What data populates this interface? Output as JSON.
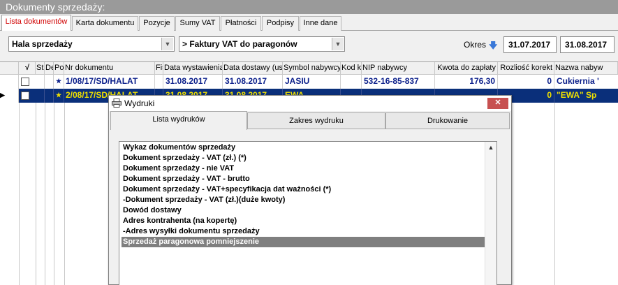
{
  "app": {
    "title": "Dokumenty sprzedaży:"
  },
  "tabs": [
    {
      "label": "Lista dokumentów",
      "active": true
    },
    {
      "label": "Karta dokumentu"
    },
    {
      "label": "Pozycje"
    },
    {
      "label": "Sumy VAT"
    },
    {
      "label": "Płatności"
    },
    {
      "label": "Podpisy"
    },
    {
      "label": "Inne dane"
    }
  ],
  "toolbar": {
    "combo1": "Hala sprzedaży",
    "combo2": "> Faktury VAT do paragonów",
    "okres_label": "Okres",
    "okres_arrow": "arrow-down-icon",
    "date_from": "31.07.2017",
    "date_to": "31.08.2017"
  },
  "grid": {
    "columns": [
      "√",
      "St",
      "De",
      "Po",
      "Nr dokumentu",
      "Fis",
      "Data wystawienia",
      "Data dostawy (usł",
      "Symbol nabywcy",
      "Kod k",
      "NIP nabywcy",
      "Kwota do zapłaty",
      "Rozliość korekt",
      "Nazwa nabyw"
    ],
    "rows": [
      {
        "nr": "1/08/17/SD/HALAT",
        "data_wyst": "31.08.2017",
        "data_dost": "31.08.2017",
        "symbol": "JASIU",
        "nip": "532-16-85-837",
        "kwota": "176,30",
        "korekt": "0",
        "nazwa": "Cukiernia '"
      },
      {
        "nr": "2/08/17/SD/HALAT",
        "data_wyst": "31.08.2017",
        "data_dost": "31.08.2017",
        "symbol": "EWA",
        "nip": "",
        "kwota": "",
        "korekt": "0",
        "nazwa": "\"EWA\" Sp"
      }
    ]
  },
  "dialog": {
    "title": "Wydruki",
    "close_label": "✕",
    "tabs": [
      {
        "label": "Lista wydruków",
        "active": true
      },
      {
        "label": "Zakres wydruku"
      },
      {
        "label": "Drukowanie"
      }
    ],
    "items": [
      "Wykaz dokumentów sprzedaży",
      "Dokument sprzedaży - VAT (zł.)  (*)",
      "Dokument sprzedaży  - nie VAT",
      "Dokument sprzedaży  - VAT - brutto",
      "Dokument sprzedaży - VAT+specyfikacja dat ważności  (*)",
      "-Dokument sprzedaży - VAT (zł.)(duże kwoty)",
      "Dowód dostawy",
      "Adres kontrahenta (na kopertę)",
      "-Adres wysyłki dokumentu sprzedaży",
      "Sprzedaż paragonowa pomniejszenie"
    ],
    "selected_index": 9
  }
}
